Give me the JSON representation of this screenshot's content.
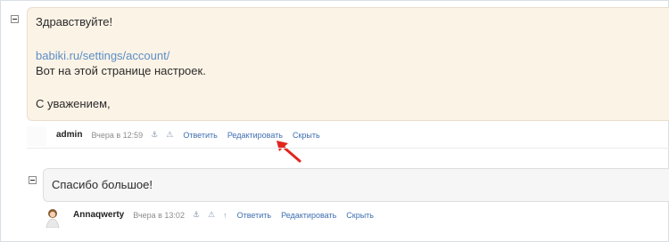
{
  "comments": [
    {
      "greeting": "Здравствуйте!",
      "link": "babiki.ru/settings/account/",
      "line2": "Вот на этой странице настроек.",
      "closing": "С уважением,",
      "author": "admin",
      "time": "Вчера в 12:59",
      "icons": [
        "anchor-icon",
        "warning-icon"
      ],
      "actions": {
        "reply": "Ответить",
        "edit": "Редактировать",
        "hide": "Скрыть"
      }
    },
    {
      "text": "Спасибо большое!",
      "author": "Annaqwerty",
      "time": "Вчера в 13:02",
      "icons": [
        "anchor-icon",
        "warning-icon",
        "arrow-up-icon"
      ],
      "actions": {
        "reply": "Ответить",
        "edit": "Редактировать",
        "hide": "Скрыть"
      }
    }
  ],
  "colors": {
    "bubble_admin": "#fbf3e6",
    "bubble_user": "#f6f6f6",
    "link": "#3f6fb1",
    "annotation_arrow": "#e1261c"
  }
}
